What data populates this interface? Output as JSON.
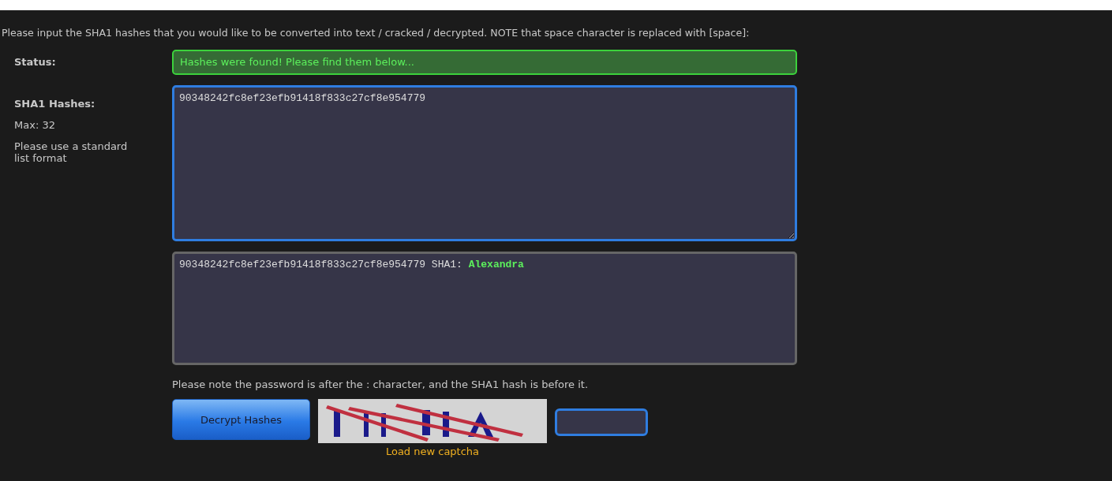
{
  "intro": "Please input the SHA1 hashes that you would like to be converted into text / cracked / decrypted. NOTE that space character is replaced with [space]:",
  "status": {
    "label": "Status:",
    "value": "Hashes were found! Please find them below...",
    "success": true
  },
  "hashes": {
    "label": "SHA1 Hashes:",
    "max": "Max: 32",
    "hint": "Please use a standard list format",
    "value": "90348242fc8ef23efb91418f833c27cf8e954779",
    "focused": true
  },
  "results": [
    {
      "text": "90348242fc8ef23efb91418f833c27cf8e954779 SHA1:",
      "password": "Alexandra"
    }
  ],
  "note": "Please note the password is after the : character, and the SHA1 hash is before it.",
  "submit": "Decrypt Hashes",
  "captcha": {
    "kind": "picture",
    "reload": "Load new captcha",
    "input_focused": true
  }
}
